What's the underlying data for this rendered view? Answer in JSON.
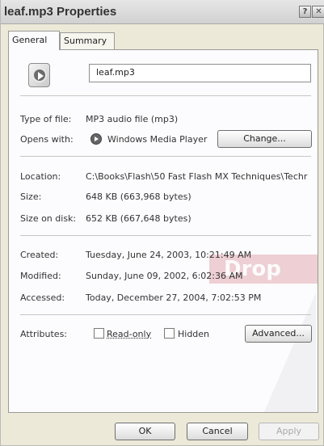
{
  "window": {
    "title": "leaf.mp3 Properties",
    "help_glyph": "?",
    "close_glyph": "✕"
  },
  "tabs": [
    {
      "label": "General"
    },
    {
      "label": "Summary"
    }
  ],
  "file": {
    "name": "leaf.mp3",
    "icon": "mp3-file-icon"
  },
  "rows": {
    "type_label": "Type of file:",
    "type_value": "MP3 audio file (mp3)",
    "opens_label": "Opens with:",
    "opens_value": "Windows Media Player",
    "opens_icon": "windows-media-player-icon",
    "change_button": "Change...",
    "location_label": "Location:",
    "location_value": "C:\\Books\\Flash\\50 Fast Flash MX Techniques\\Techr",
    "size_label": "Size:",
    "size_value": "648 KB (663,968 bytes)",
    "size_disk_label": "Size on disk:",
    "size_disk_value": "652 KB (667,648 bytes)",
    "created_label": "Created:",
    "created_value": "Tuesday, June 24, 2003, 10:21:49 AM",
    "modified_label": "Modified:",
    "modified_value": "Sunday, June 09, 2002, 6:02:36 AM",
    "accessed_label": "Accessed:",
    "accessed_value": "Today, December 27, 2004, 7:02:53 PM",
    "attributes_label": "Attributes:",
    "readonly_label": "Read-only",
    "hidden_label": "Hidden",
    "advanced_button": "Advanced..."
  },
  "footer": {
    "ok": "OK",
    "cancel": "Cancel",
    "apply": "Apply"
  },
  "watermark_text": "Drop"
}
